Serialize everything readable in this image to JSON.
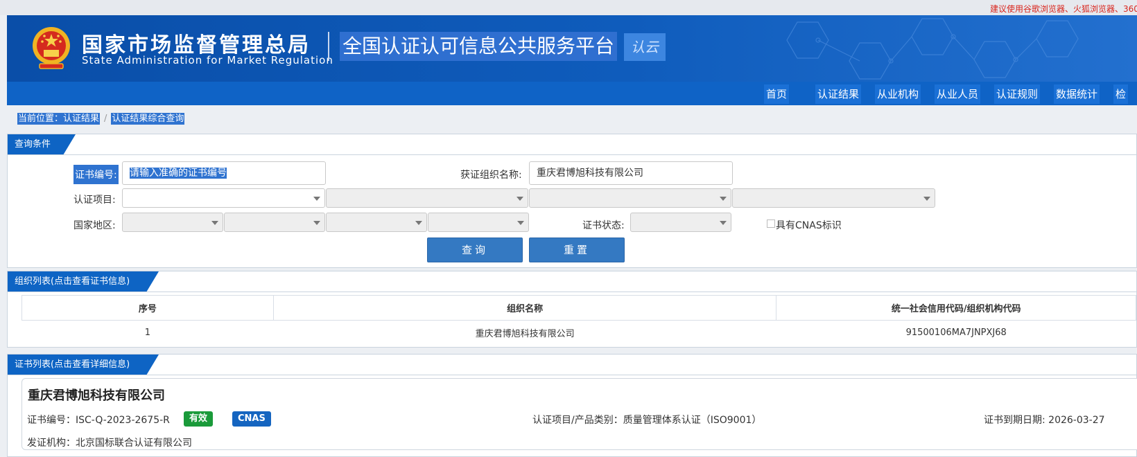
{
  "top_notice": "建议使用谷歌浏览器、火狐浏览器、360",
  "header": {
    "org_cn": "国家市场监督管理总局",
    "org_en": "State Administration  for  Market Regulation",
    "platform_title": "全国认证认可信息公共服务平台",
    "badge_text": "认云"
  },
  "nav": [
    "首页",
    "认证结果",
    "从业机构",
    "从业人员",
    "认证规则",
    "数据统计",
    "检"
  ],
  "breadcrumb": {
    "location": "当前位置：认证结果",
    "separator": "/",
    "page": "认证结果综合查询"
  },
  "query_panel": {
    "title": "查询条件",
    "cert_no_label": "证书编号:",
    "cert_no_placeholder": "请输入准确的证书编号",
    "org_name_label": "获证组织名称:",
    "org_name_value": "重庆君博旭科技有限公司",
    "project_label": "认证项目:",
    "region_label": "国家地区:",
    "status_label": "证书状态:",
    "cnas_label": "具有CNAS标识",
    "query_button": "查询",
    "reset_button": "重置"
  },
  "org_list": {
    "title": "组织列表(点击查看证书信息)",
    "columns": [
      "序号",
      "组织名称",
      "统一社会信用代码/组织机构代码"
    ],
    "rows": [
      [
        "1",
        "重庆君博旭科技有限公司",
        "91500106MA7JNPXJ68"
      ]
    ]
  },
  "cert_list": {
    "title": "证书列表(点击查看详细信息)",
    "card": {
      "company": "重庆君博旭科技有限公司",
      "cert_no": "证书编号：ISC-Q-2023-2675-R",
      "status_badge": "有效",
      "cnas_badge": "CNAS",
      "project": "认证项目/产品类别：质量管理体系认证（ISO9001）",
      "expiry": "证书到期日期: 2026-03-27",
      "issuer": "发证机构：北京国标联合认证有限公司"
    }
  },
  "colors": {
    "header_blue": "#0a4ea8",
    "nav_blue": "#0f63c6",
    "panel_tab_blue": "#0e64c4",
    "button_blue": "#3479c2",
    "valid_green": "#1a9a3a",
    "cnas_blue": "#1565c0",
    "notice_red": "#d9251c"
  }
}
